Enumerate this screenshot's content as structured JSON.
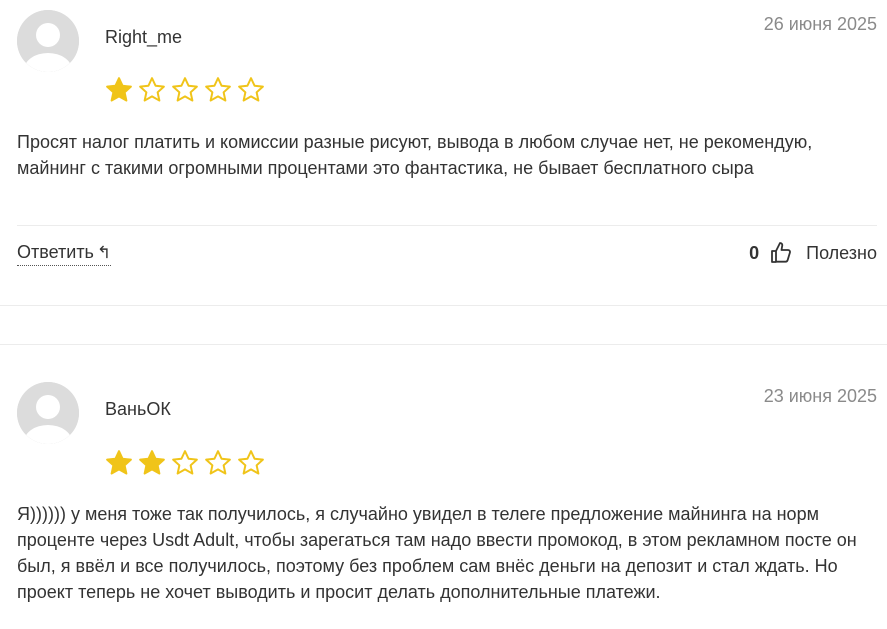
{
  "colors": {
    "star_filled": "#f0c419",
    "star_empty": "#f0c419",
    "date": "#8a8a8a"
  },
  "reviews": [
    {
      "author": "Right_me",
      "date": "26 июня 2025",
      "rating": 1,
      "rating_max": 5,
      "text": "Просят налог платить и комиссии разные рисуют, вывода в любом случае нет, не рекомендую, майнинг с такими огромными процентами это фантастика, не бывает бесплатного сыра",
      "reply_label": "Ответить",
      "reply_icon": "reply-arrow-icon",
      "helpful_count": "0",
      "helpful_label": "Полезно"
    },
    {
      "author": "ВаньОК",
      "date": "23 июня 2025",
      "rating": 2,
      "rating_max": 5,
      "text": "Я)))))) у меня тоже так получилось, я случайно увидел в телеге предложение майнинга на норм проценте через Usdt Adult, чтобы зарегаться там надо ввести промокод, в этом рекламном посте он был, я ввёл и все получилось, поэтому без проблем сам внёс деньги на депозит и стал ждать. Но проект теперь не хочет выводить и просит делать дополнительные платежи."
    }
  ]
}
